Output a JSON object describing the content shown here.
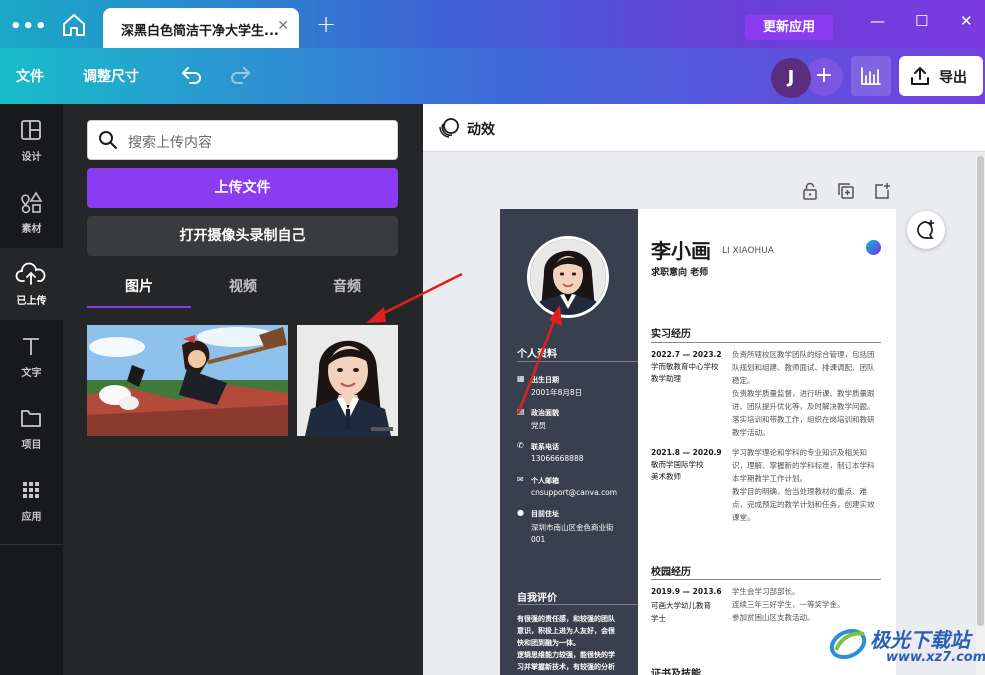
{
  "titlebar": {
    "tab_title": "深黑白色简洁干净大学生...",
    "update_label": "更新应用"
  },
  "toolbar": {
    "file_label": "文件",
    "resize_label": "调整尺寸",
    "avatar_initial": "J",
    "export_label": "导出"
  },
  "rail": {
    "items": [
      {
        "label": "设计",
        "icon": "layout-icon"
      },
      {
        "label": "素材",
        "icon": "shapes-icon"
      },
      {
        "label": "已上传",
        "icon": "upload-cloud-icon"
      },
      {
        "label": "文字",
        "icon": "text-icon"
      },
      {
        "label": "项目",
        "icon": "folder-icon"
      },
      {
        "label": "应用",
        "icon": "apps-grid-icon"
      }
    ]
  },
  "panel": {
    "search_placeholder": "搜索上传内容",
    "upload_label": "上传文件",
    "camera_label": "打开摄像头录制自己",
    "tabs": [
      {
        "label": "图片"
      },
      {
        "label": "视频"
      },
      {
        "label": "音频"
      }
    ]
  },
  "canvas": {
    "animation_label": "动效"
  },
  "resume": {
    "name": "李小画",
    "name_pinyin": "LI XIAOHUA",
    "intent": "求职意向 老师",
    "personal_title": "个人资料",
    "personal": [
      {
        "label": "出生日期",
        "value": "2001年8月8日"
      },
      {
        "label": "政治面貌",
        "value": "党员"
      },
      {
        "label": "联系电话",
        "value": "13066668888"
      },
      {
        "label": "个人邮箱",
        "value": "cnsupport@canva.com"
      },
      {
        "label": "目前住址",
        "value": "深圳市南山区金色商业街",
        "value2": "001"
      }
    ],
    "self_title": "自我评价",
    "self_lines": [
      "有很强的责任感，和较强的团队",
      "意识，积极上进为人友好，会很",
      "快和团到融为一体。",
      "逻辑思维能力较强，能很快的学",
      "习并掌握新技术，有较强的分析"
    ],
    "internship_title": "实习经历",
    "internship": [
      {
        "date": "2022.7 — 2023.2",
        "org": [
          "学而敏教育中心学校",
          "教学助理"
        ],
        "desc": [
          "负责所辖校区教学团队的综合管理，包括团",
          "队规划和组建、教师面试、排课调配、团队",
          "稳定。",
          "负责教学质量监督，进行听课、教学质量跟",
          "进、团队提升优化等，及时解决教学问题。",
          "落实培训和带教工作，组织在岗培训和教研",
          "教学活动。"
        ]
      },
      {
        "date": "2021.8 — 2020.9",
        "org": [
          "敏而学国际学校",
          "美术教师"
        ],
        "desc": [
          "学习教学理论和学科的专业知识及相关知",
          "识，理解、掌握新的学科标准，制订本学科",
          "本学期教学工作计划。",
          "教学目的明确，恰当处理教材的重点、难",
          "点，完成预定的教学计划和任务，创建实效",
          "课堂。"
        ]
      }
    ],
    "campus_title": "校园经历",
    "campus": {
      "date": "2019.9 — 2013.6",
      "org": [
        "可画大学幼儿教育",
        "学士"
      ],
      "desc": [
        "学生会学习部部长。",
        "连续三年三好学生，一等奖学金。",
        "参加贫困山区支教活动。"
      ]
    },
    "skills_title": "证书及技能"
  },
  "watermark": {
    "text": "极光下载站",
    "url": "www.xz7.com"
  },
  "colors": {
    "accent": "#8b3cf0",
    "rail_bg": "#18191b",
    "panel_bg": "#252627",
    "resume_side": "#39404d",
    "arrow": "#e0201e"
  }
}
